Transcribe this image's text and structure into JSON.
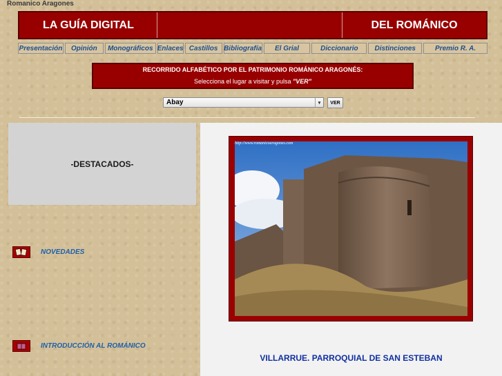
{
  "site": {
    "title": "Romanico Aragones"
  },
  "banner": {
    "left": "LA GUÍA DIGITAL",
    "right": "DEL ROMÁNICO"
  },
  "nav": {
    "items": [
      {
        "label": "Presentación",
        "w": 66
      },
      {
        "label": "Opinión",
        "w": 56
      },
      {
        "label": "Monográficos",
        "w": 74
      },
      {
        "label": "Enlaces",
        "w": 38
      },
      {
        "label": "Castillos",
        "w": 54
      },
      {
        "label": "Bibliografía",
        "w": 56
      },
      {
        "label": "El Grial",
        "w": 68
      },
      {
        "label": "Diccionario",
        "w": 80
      },
      {
        "label": "Distinciones",
        "w": 78
      },
      {
        "label": "Premio R. A.",
        "w": 93
      }
    ]
  },
  "notice": {
    "line1": "RECORRIDO ALFABÉTICO POR EL PATRIMONIO ROMÁNICO ARAGONÉS:",
    "line2_prefix": "Selecciona el lugar a visitar y pulsa ",
    "line2_bold": "\"VER\""
  },
  "selector": {
    "value": "Abay",
    "button": "VER"
  },
  "sidebar": {
    "destacados": "-DESTACADOS-",
    "links": [
      {
        "label": "NOVEDADES",
        "icon": "cards-icon"
      },
      {
        "label": "INTRODUCCIÓN AL ROMÁNICO",
        "icon": "book-icon"
      }
    ]
  },
  "feature": {
    "photo_url": "http://www.romanicoaragones.com",
    "caption": "VILLARRUE. PARROQUIAL DE SAN ESTEBAN"
  },
  "colors": {
    "banner_red": "#980000",
    "link_blue": "#1d5fa8",
    "caption_blue": "#1030a0"
  }
}
